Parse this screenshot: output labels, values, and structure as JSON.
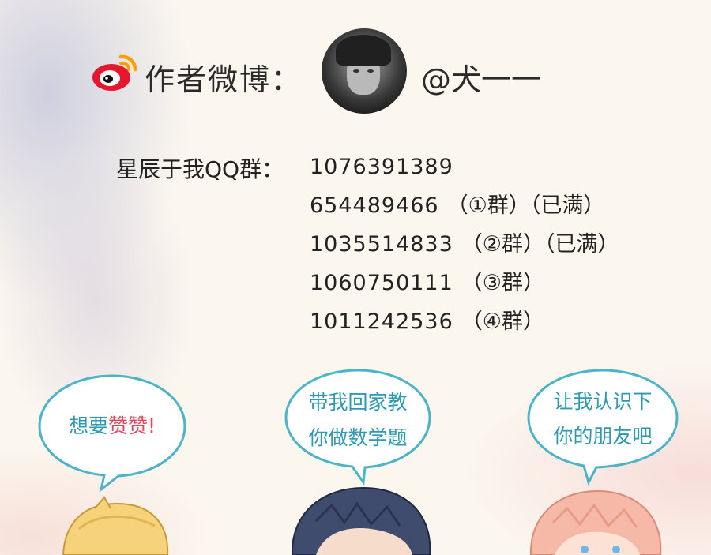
{
  "header": {
    "weibo_label": "作者微博：",
    "handle": "@犬一一",
    "logo_icon": "weibo-icon",
    "brand_colors": {
      "logo_red": "#e6162d",
      "logo_orange": "#f7a000"
    }
  },
  "qq": {
    "label": "星辰于我QQ群：",
    "groups": [
      {
        "number": "1076391389",
        "note": ""
      },
      {
        "number": "654489466",
        "note": "（①群）（已满）"
      },
      {
        "number": "1035514833",
        "note": "（②群）（已满）"
      },
      {
        "number": "1060750111",
        "note": "（③群）"
      },
      {
        "number": "1011242536",
        "note": "（④群）"
      }
    ]
  },
  "bubbles": {
    "left": {
      "prefix": "想要",
      "highlight": "赞赞",
      "suffix": "!"
    },
    "middle": {
      "line1": "带我回家教",
      "line2": "你做数学题"
    },
    "right": {
      "line1": "让我认识下",
      "line2": "你的朋友吧"
    }
  },
  "colors": {
    "bubble_text": "#2c9ab0",
    "bubble_stroke": "#4bb4c8",
    "highlight": "#e8435a"
  }
}
